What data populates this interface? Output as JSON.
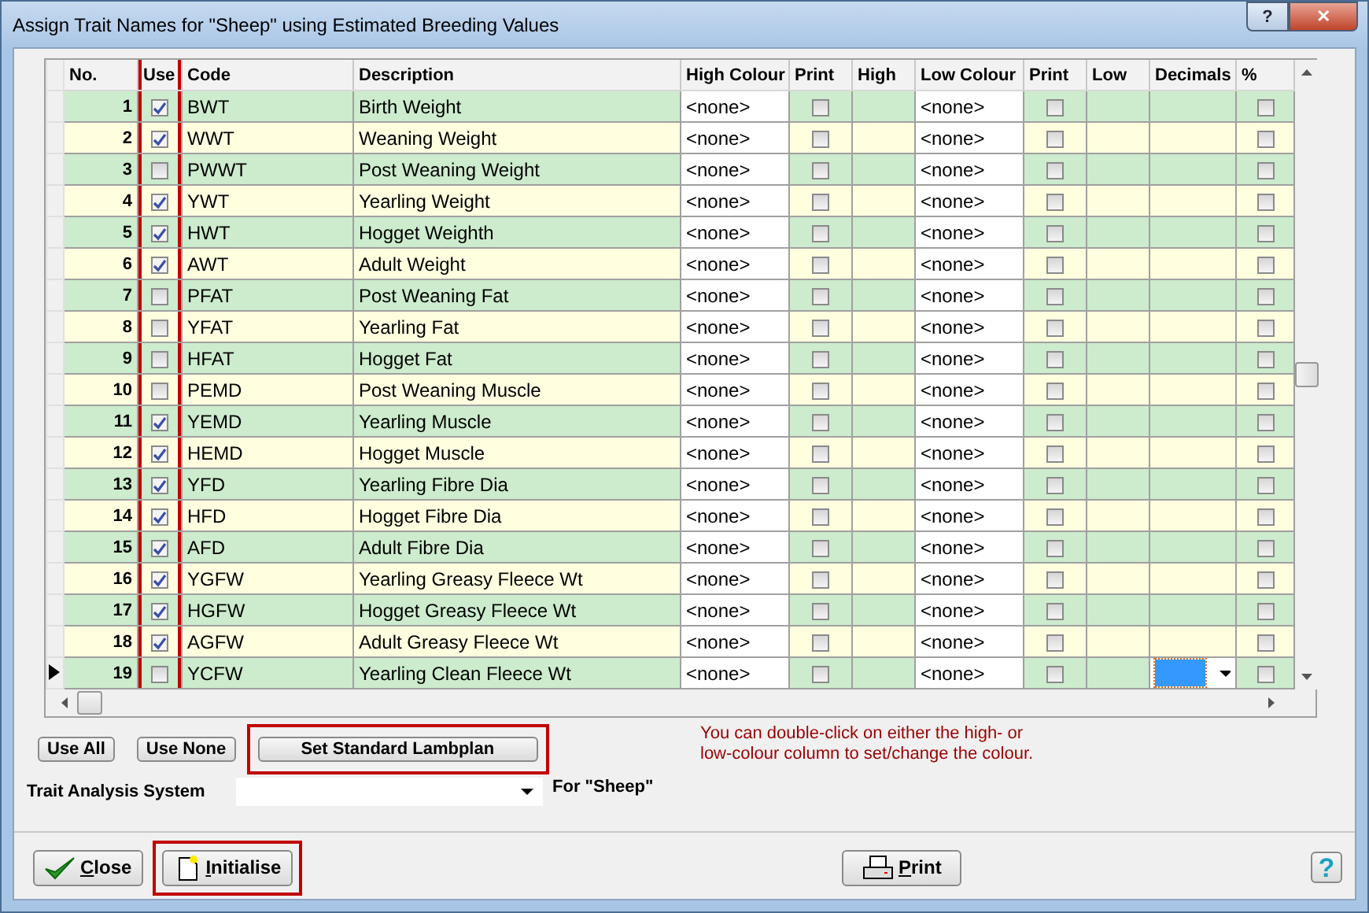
{
  "window": {
    "title": "Assign Trait Names for \"Sheep\" using Estimated Breeding Values",
    "help_glyph": "?",
    "close_glyph": "✕"
  },
  "table": {
    "columns": [
      {
        "label": "No.",
        "highlighted": false
      },
      {
        "label": "Use",
        "highlighted": true
      },
      {
        "label": "Code",
        "highlighted": false
      },
      {
        "label": "Description",
        "highlighted": false
      },
      {
        "label": "High Colour",
        "highlighted": false
      },
      {
        "label": "Print",
        "highlighted": false
      },
      {
        "label": "High",
        "highlighted": false
      },
      {
        "label": "Low Colour",
        "highlighted": false
      },
      {
        "label": "Print",
        "highlighted": false
      },
      {
        "label": "Low",
        "highlighted": false
      },
      {
        "label": "Decimals",
        "highlighted": false
      },
      {
        "label": "%",
        "highlighted": false
      }
    ],
    "rows": [
      {
        "no": "1",
        "use": true,
        "code": "BWT",
        "description": "Birth Weight",
        "high_colour": "<none>",
        "print_high": false,
        "low_colour": "<none>",
        "print_low": false,
        "percent": false,
        "current": false
      },
      {
        "no": "2",
        "use": true,
        "code": "WWT",
        "description": "Weaning Weight",
        "high_colour": "<none>",
        "print_high": false,
        "low_colour": "<none>",
        "print_low": false,
        "percent": false,
        "current": false
      },
      {
        "no": "3",
        "use": false,
        "code": "PWWT",
        "description": "Post Weaning Weight",
        "high_colour": "<none>",
        "print_high": false,
        "low_colour": "<none>",
        "print_low": false,
        "percent": false,
        "current": false
      },
      {
        "no": "4",
        "use": true,
        "code": "YWT",
        "description": "Yearling Weight",
        "high_colour": "<none>",
        "print_high": false,
        "low_colour": "<none>",
        "print_low": false,
        "percent": false,
        "current": false
      },
      {
        "no": "5",
        "use": true,
        "code": "HWT",
        "description": "Hogget Weighth",
        "high_colour": "<none>",
        "print_high": false,
        "low_colour": "<none>",
        "print_low": false,
        "percent": false,
        "current": false
      },
      {
        "no": "6",
        "use": true,
        "code": "AWT",
        "description": "Adult Weight",
        "high_colour": "<none>",
        "print_high": false,
        "low_colour": "<none>",
        "print_low": false,
        "percent": false,
        "current": false
      },
      {
        "no": "7",
        "use": false,
        "code": "PFAT",
        "description": "Post Weaning Fat",
        "high_colour": "<none>",
        "print_high": false,
        "low_colour": "<none>",
        "print_low": false,
        "percent": false,
        "current": false
      },
      {
        "no": "8",
        "use": false,
        "code": "YFAT",
        "description": "Yearling Fat",
        "high_colour": "<none>",
        "print_high": false,
        "low_colour": "<none>",
        "print_low": false,
        "percent": false,
        "current": false
      },
      {
        "no": "9",
        "use": false,
        "code": "HFAT",
        "description": "Hogget Fat",
        "high_colour": "<none>",
        "print_high": false,
        "low_colour": "<none>",
        "print_low": false,
        "percent": false,
        "current": false
      },
      {
        "no": "10",
        "use": false,
        "code": "PEMD",
        "description": "Post Weaning Muscle",
        "high_colour": "<none>",
        "print_high": false,
        "low_colour": "<none>",
        "print_low": false,
        "percent": false,
        "current": false
      },
      {
        "no": "11",
        "use": true,
        "code": "YEMD",
        "description": "Yearling Muscle",
        "high_colour": "<none>",
        "print_high": false,
        "low_colour": "<none>",
        "print_low": false,
        "percent": false,
        "current": false
      },
      {
        "no": "12",
        "use": true,
        "code": "HEMD",
        "description": "Hogget Muscle",
        "high_colour": "<none>",
        "print_high": false,
        "low_colour": "<none>",
        "print_low": false,
        "percent": false,
        "current": false
      },
      {
        "no": "13",
        "use": true,
        "code": "YFD",
        "description": "Yearling Fibre Dia",
        "high_colour": "<none>",
        "print_high": false,
        "low_colour": "<none>",
        "print_low": false,
        "percent": false,
        "current": false
      },
      {
        "no": "14",
        "use": true,
        "code": "HFD",
        "description": "Hogget Fibre Dia",
        "high_colour": "<none>",
        "print_high": false,
        "low_colour": "<none>",
        "print_low": false,
        "percent": false,
        "current": false
      },
      {
        "no": "15",
        "use": true,
        "code": "AFD",
        "description": "Adult Fibre Dia",
        "high_colour": "<none>",
        "print_high": false,
        "low_colour": "<none>",
        "print_low": false,
        "percent": false,
        "current": false
      },
      {
        "no": "16",
        "use": true,
        "code": "YGFW",
        "description": "Yearling Greasy Fleece Wt",
        "high_colour": "<none>",
        "print_high": false,
        "low_colour": "<none>",
        "print_low": false,
        "percent": false,
        "current": false
      },
      {
        "no": "17",
        "use": true,
        "code": "HGFW",
        "description": "Hogget Greasy Fleece Wt",
        "high_colour": "<none>",
        "print_high": false,
        "low_colour": "<none>",
        "print_low": false,
        "percent": false,
        "current": false
      },
      {
        "no": "18",
        "use": true,
        "code": "AGFW",
        "description": "Adult Greasy Fleece Wt",
        "high_colour": "<none>",
        "print_high": false,
        "low_colour": "<none>",
        "print_low": false,
        "percent": false,
        "current": false
      },
      {
        "no": "19",
        "use": false,
        "code": "YCFW",
        "description": "Yearling Clean Fleece Wt",
        "high_colour": "<none>",
        "print_high": false,
        "low_colour": "<none>",
        "print_low": false,
        "percent": false,
        "current": true
      }
    ]
  },
  "actions": [
    {
      "label": "Use All",
      "highlighted": false
    },
    {
      "label": "Use None",
      "highlighted": false
    },
    {
      "label": "Set Standard Lambplan",
      "highlighted": true
    }
  ],
  "hint": "You can double-click on either the high- or low-colour column to set/change the colour.",
  "trait_system": {
    "label": "Trait Analysis System",
    "for_label": "For \"Sheep\""
  },
  "footer": [
    {
      "label": "Close",
      "kind": "close",
      "highlighted": false
    },
    {
      "label": "Initialise",
      "kind": "initialise",
      "highlighted": true
    },
    {
      "label": "Print",
      "kind": "print",
      "highlighted": false
    },
    {
      "label": "?",
      "kind": "help",
      "highlighted": false
    }
  ]
}
